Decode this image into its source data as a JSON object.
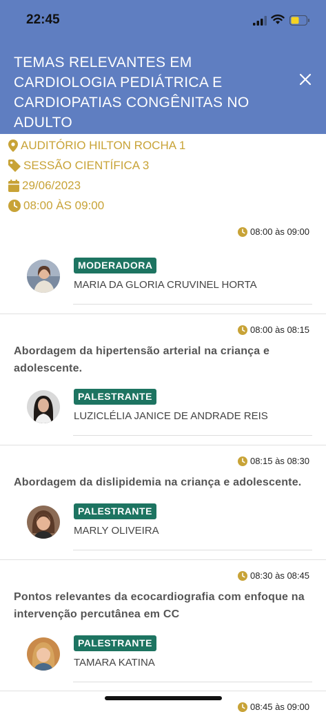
{
  "status": {
    "time": "22:45"
  },
  "header": {
    "title": "TEMAS RELEVANTES EM CARDIOLOGIA PEDIÁTRICA E CARDIOPATIAS CONGÊNITAS NO ADULTO"
  },
  "info": {
    "location": "AUDITÓRIO HILTON ROCHA 1",
    "session": "SESSÃO CIENTÍFICA 3",
    "date": "29/06/2023",
    "time": "08:00 ÀS 09:00"
  },
  "sessions": [
    {
      "time": "08:00 às 09:00",
      "topic": "",
      "role": "MODERADORA",
      "speaker": "MARIA DA GLORIA CRUVINEL HORTA"
    },
    {
      "time": "08:00 às 08:15",
      "topic": "Abordagem da hipertensão arterial na criança e adolescente.",
      "role": "PALESTRANTE",
      "speaker": "LUZICLÉLIA JANICE DE ANDRADE REIS"
    },
    {
      "time": "08:15 às 08:30",
      "topic": "Abordagem da dislipidemia na criança e adolescente.",
      "role": "PALESTRANTE",
      "speaker": "MARLY OLIVEIRA"
    },
    {
      "time": "08:30 às 08:45",
      "topic": "Pontos relevantes da ecocardiografia com enfoque na intervenção percutânea em CC",
      "role": "PALESTRANTE",
      "speaker": "TAMARA KATINA"
    },
    {
      "time": "08:45 às 09:00"
    }
  ],
  "colors": {
    "header": "#5f7ec1",
    "accent": "#c8a337",
    "badge": "#1d7461"
  }
}
